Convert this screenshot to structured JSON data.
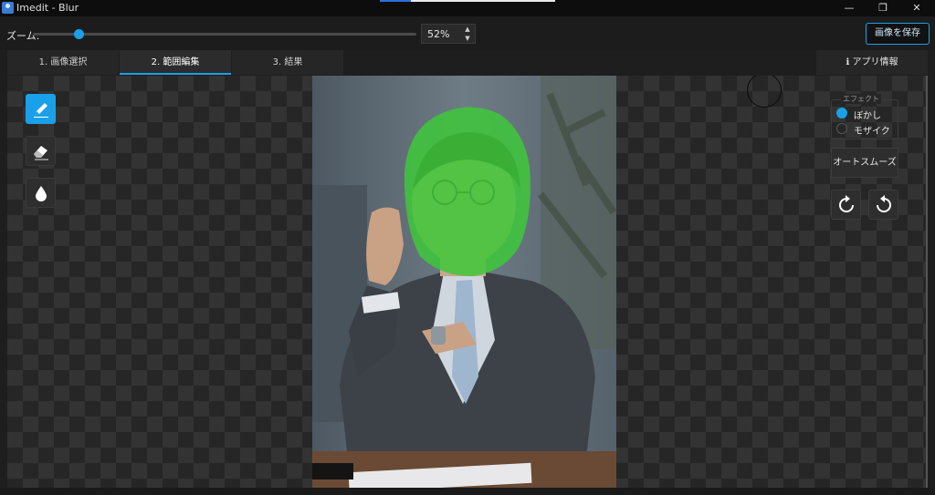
{
  "window": {
    "title": "Imedit - Blur",
    "minimize_icon": "minimize-icon",
    "restore_icon": "restore-icon",
    "close_icon": "close-icon"
  },
  "toolbar": {
    "zoom_label": "ズーム:",
    "zoom_value": "52%",
    "zoom_fraction": 0.12,
    "save_label": "画像を保存"
  },
  "tabs": [
    {
      "label": "1. 画像選択",
      "active": false
    },
    {
      "label": "2. 範囲編集",
      "active": true
    },
    {
      "label": "3. 結果",
      "active": false
    }
  ],
  "info_tab": {
    "label": "アプリ情報",
    "icon": "info-icon"
  },
  "tools": [
    {
      "icon": "pencil-icon",
      "active": true
    },
    {
      "icon": "eraser-icon",
      "active": false
    },
    {
      "icon": "droplet-icon",
      "active": false
    }
  ],
  "effect": {
    "legend": "エフェクト",
    "options": [
      {
        "label": "ぼかし",
        "checked": true
      },
      {
        "label": "モザイク",
        "checked": false
      }
    ]
  },
  "auto_smooth_label": "オートスムーズ",
  "rotate": {
    "clockwise_icon": "rotate-clockwise-icon",
    "counterclockwise_icon": "rotate-counterclockwise-icon"
  },
  "colors": {
    "accent": "#1aa0e8",
    "mask": "#3ec83a",
    "background": "#1e1e1e"
  }
}
